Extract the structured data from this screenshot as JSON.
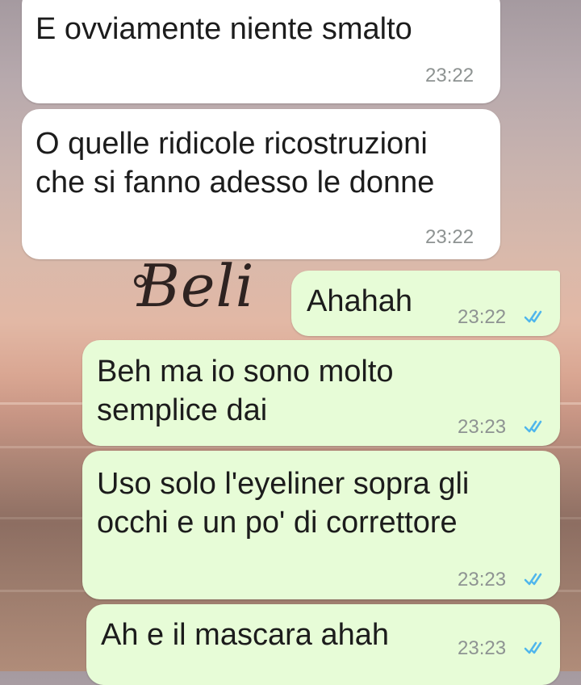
{
  "wallpaper": {
    "text": "Beli"
  },
  "messages": [
    {
      "direction": "in",
      "text": "E ovviamente niente smalto",
      "time": "23:22"
    },
    {
      "direction": "in",
      "text": "O quelle ridicole ricostruzioni\nche si fanno adesso le donne",
      "time": "23:22"
    },
    {
      "direction": "out",
      "text": "Ahahah",
      "time": "23:22",
      "status": "read-ticks-icon"
    },
    {
      "direction": "out",
      "text": "Beh ma io sono molto\nsemplice dai",
      "time": "23:23",
      "status": "read-ticks-icon"
    },
    {
      "direction": "out",
      "text": "Uso solo l'eyeliner sopra gli\nocchi e un po' di correttore",
      "time": "23:23",
      "status": "read-ticks-icon"
    },
    {
      "direction": "out",
      "text": "Ah e il mascara ahah",
      "time": "23:23",
      "status": "read-ticks-icon"
    }
  ],
  "colors": {
    "incoming_bubble": "#ffffff",
    "outgoing_bubble": "#e7fcd7",
    "read_ticks": "#4fb6ec",
    "timestamp": "#8e9392"
  }
}
